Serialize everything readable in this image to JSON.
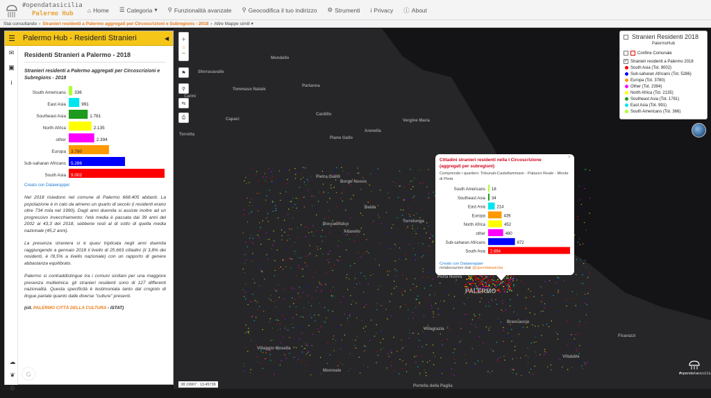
{
  "brand": {
    "line1": "#opendatasicilia",
    "line2": "Palermo Hub"
  },
  "nav": [
    {
      "label": "Home",
      "icon": "home-icon",
      "glyph": "⌂"
    },
    {
      "label": "Categoria",
      "icon": "list-icon",
      "glyph": "☰",
      "caret": "▾"
    },
    {
      "label": "Funzionalità avanzate",
      "icon": "search-icon",
      "glyph": "⚲"
    },
    {
      "label": "Geocodifica il tuo indirizzo",
      "icon": "map-marker-icon",
      "glyph": "⚲"
    },
    {
      "label": "Strumenti",
      "icon": "gear-icon",
      "glyph": "⚙"
    },
    {
      "label": "Privacy",
      "icon": "info-icon",
      "glyph": "i"
    },
    {
      "label": "About",
      "icon": "info-circle-icon",
      "glyph": "ⓘ"
    }
  ],
  "breadcrumb": {
    "prefix": "Stai consultando",
    "current": "Stranieri residenti a Palermo aggregati per Circoscrizioni e Subregions - 2018",
    "more": "Altre Mappe simili ▾"
  },
  "panel": {
    "title": "Palermo Hub - Residenti Stranieri",
    "heading": "Residenti Stranieri a Palermo - 2018",
    "datawrapper_link": "Creato con Datawrapper",
    "paragraphs": [
      "Nel 2018 risiedono nel comune di Palermo 668.405 abitanti. La popolazione è in calo da almeno un quarto di secolo (i residenti erano oltre 734 mila nel 1990). Dagli anni duemila si assiste inoltre ad un progressivo invecchiamento: l'età media è passata dai 39 anni del 2002 ai 43,3 del 2018, sebbene resti al di sotto di quella media nazionale (45,2 anni).",
      "La presenza straniera si è quasi triplicata negli anni duemila raggiungendo a gennaio 2018 il livello di 25.663 cittadini (il 3,8% dei residenti, è l'8,5% a livello nazionale) con un rapporto di genere abbastanza equilibrato.",
      "Palermo si contraddistingue tra i comuni siciliani per una maggiore presenza multietnica: gli stranieri residenti sono di 127 differenti nazionalità. Questa specificità è testimoniata tanto dal crogiolo di lingue parlate quanto dalle diverse \"culture\" presenti."
    ],
    "credit": {
      "open": "(cit.",
      "highlight": "PALERMO CITTÀ DELLA CULTURA",
      "close": "- ISTAT)"
    }
  },
  "chart_data": [
    {
      "type": "bar",
      "title": "Stranieri residenti a Palermo aggregati per Circoscrizioni e Subregions - 2018",
      "categories": [
        "South Americans",
        "East Asia",
        "Southeast Asia",
        "North Africa",
        "other",
        "Europa",
        "Sub-saharan Africans",
        "South Asia"
      ],
      "values": [
        336,
        991,
        1781,
        2135,
        2394,
        3780,
        5286,
        9002
      ],
      "value_labels": [
        "336",
        "991",
        "1.781",
        "2.135",
        "2.394",
        "3.780",
        "5.286",
        "9.002"
      ],
      "colors": [
        "#adff2f",
        "#00e5ee",
        "#1e9a1e",
        "#ffff00",
        "#ff00ff",
        "#ff9900",
        "#0000ff",
        "#ff0000"
      ],
      "xlim": [
        0,
        9002
      ]
    },
    {
      "type": "bar",
      "title": "Cittadini stranieri residenti nella I Circoscrizione (aggregati per subregioni)",
      "categories": [
        "South Americans",
        "Southeast Asia",
        "East Asia",
        "Europa",
        "North Africa",
        "other",
        "Sub-saharan Africans",
        "South Asia"
      ],
      "values": [
        18,
        34,
        214,
        439,
        452,
        490,
        872,
        2664
      ],
      "value_labels": [
        "18",
        "34",
        "214",
        "439",
        "452",
        "490",
        "872",
        "2.664"
      ],
      "colors": [
        "#adff2f",
        "#1e9a1e",
        "#00e5ee",
        "#ff9900",
        "#ffff00",
        "#ff00ff",
        "#0000ff",
        "#ff0000"
      ],
      "xlim": [
        0,
        2664
      ]
    }
  ],
  "popup": {
    "title_line1": "Cittadini stranieri residenti nella I Circoscrizione",
    "title_line2": "(aggregati per subregioni)",
    "desc": "Comprende i quartieri: Tribunali-Castellammare - Palazzo Reale - Monte di Pietà",
    "link": "Creato con Datawrapper",
    "rel_prefix": "rielaborazioni dati",
    "rel_handle": "@opendatasicilia",
    "close": "×"
  },
  "legend": {
    "title": "Stranieri Residenti 2018",
    "subtitle": "PalermoHub",
    "layer1": "Confine Comunale",
    "layer2": "Stranieri residenti a Palermo 2018",
    "items": [
      {
        "label": "South Asia (Tot. 9002)",
        "color": "#ff0000"
      },
      {
        "label": "Sub-saharan Africans (Tot. 5286)",
        "color": "#0000ff"
      },
      {
        "label": "Europa (Tot. 3780)",
        "color": "#ff9900"
      },
      {
        "label": "Other (Tot. 2394)",
        "color": "#ff00ff"
      },
      {
        "label": "North Africa (Tot. 2135)",
        "color": "#ffff00"
      },
      {
        "label": "Southeast Asia (Tot. 1781)",
        "color": "#1e9a1e"
      },
      {
        "label": "East Asia (Tot. 991)",
        "color": "#00e5ee"
      },
      {
        "label": "South Americans (Tot. 366)",
        "color": "#adff2f"
      }
    ]
  },
  "coords": "38.19907 : 13.45739",
  "map_logo": "#opendatasicilia",
  "places": [
    {
      "t": "Capaci",
      "big": false
    },
    {
      "t": "Carini",
      "big": false
    },
    {
      "t": "Sferracavallo",
      "big": false
    },
    {
      "t": "Mondello",
      "big": false
    },
    {
      "t": "Tommaso Natale",
      "big": false
    },
    {
      "t": "Torretta",
      "big": false
    },
    {
      "t": "Partanna",
      "big": false
    },
    {
      "t": "Cardillo",
      "big": false
    },
    {
      "t": "Arenella",
      "big": false
    },
    {
      "t": "Piano Gallo",
      "big": false
    },
    {
      "t": "Pietra Giallo",
      "big": false
    },
    {
      "t": "Borgo Nuovo",
      "big": false
    },
    {
      "t": "Baida",
      "big": false
    },
    {
      "t": "Boccadifalco",
      "big": false
    },
    {
      "t": "Altarello",
      "big": false
    },
    {
      "t": "Torrelunga",
      "big": false
    },
    {
      "t": "PALERMO",
      "big": true
    },
    {
      "t": "Villagrazia",
      "big": false
    },
    {
      "t": "Monreale",
      "big": false
    },
    {
      "t": "Villaggio Mosella",
      "big": false
    },
    {
      "t": "Brancaccio",
      "big": false
    },
    {
      "t": "Villabate",
      "big": false
    },
    {
      "t": "Portella della Paglia",
      "big": false
    },
    {
      "t": "Ficarazzi",
      "big": false
    },
    {
      "t": "Porta Nuova",
      "big": false
    },
    {
      "t": "Vergine Maria",
      "big": false
    }
  ]
}
